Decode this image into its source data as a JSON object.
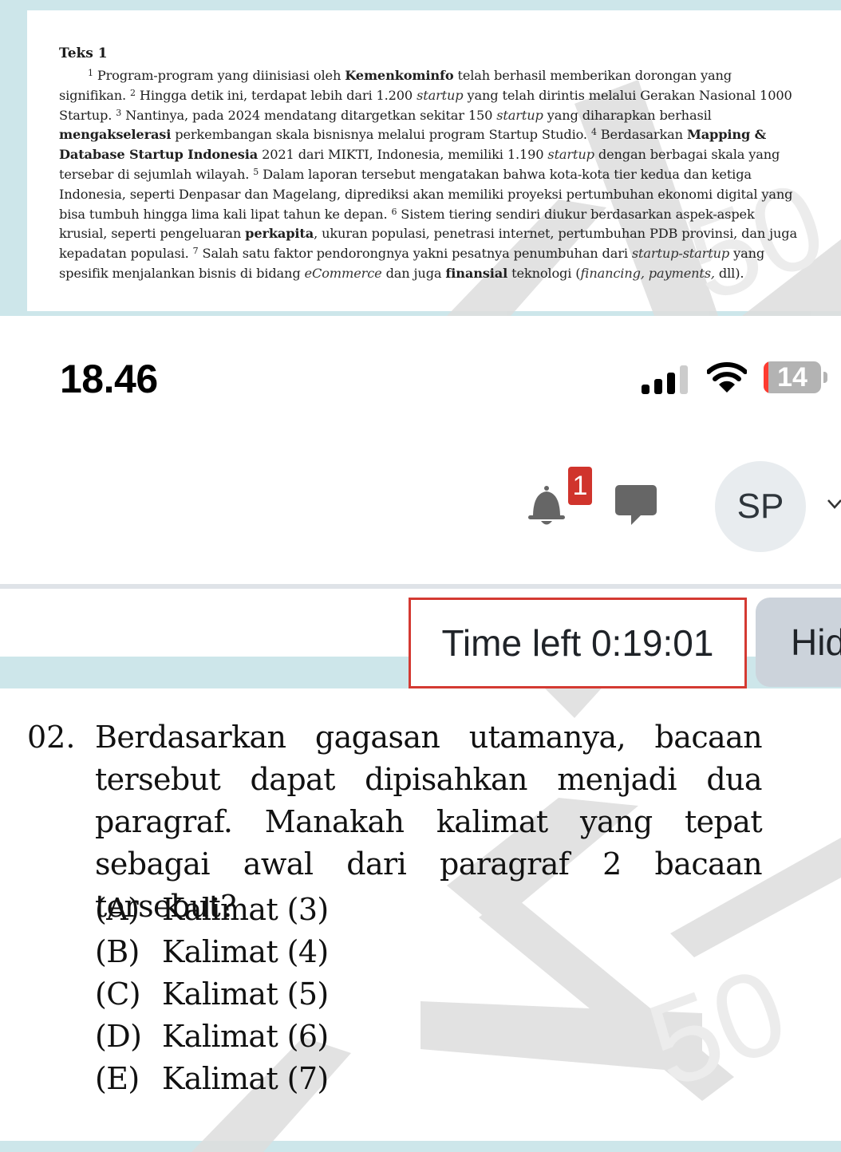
{
  "passage": {
    "title": "Teks 1",
    "sentences": [
      {
        "n": "1",
        "html": "Program-program yang diinisiasi oleh <b>Kemenkominfo</b> telah berhasil memberikan dorongan yang signifikan."
      },
      {
        "n": "2",
        "html": "Hingga detik ini, terdapat lebih dari 1.200 <i>startup</i> yang telah dirintis melalui Gerakan Nasional 1000 Startup."
      },
      {
        "n": "3",
        "html": "Nantinya, pada 2024 mendatang ditargetkan sekitar 150 <i>startup</i> yang diharapkan berhasil <b>mengakselerasi</b> perkembangan skala bisnisnya melalui program Startup Studio."
      },
      {
        "n": "4",
        "html": "Berdasarkan <b>Mapping &amp; Database Startup Indonesia</b> 2021 dari MIKTI, Indonesia, memiliki 1.190 <i>startup</i> dengan berbagai skala yang tersebar di sejumlah wilayah."
      },
      {
        "n": "5",
        "html": "Dalam laporan tersebut mengatakan bahwa kota-kota tier kedua dan ketiga Indonesia, seperti Denpasar dan Magelang, diprediksi akan memiliki proyeksi pertumbuhan ekonomi digital yang bisa tumbuh hingga lima kali lipat tahun ke depan."
      },
      {
        "n": "6",
        "html": "Sistem tiering sendiri diukur berdasarkan aspek-aspek krusial, seperti pengeluaran <b>perkapita</b>, ukuran populasi, penetrasi internet, pertumbuhan PDB provinsi, dan juga kepadatan populasi."
      },
      {
        "n": "7",
        "html": "Salah satu faktor pendorongnya yakni pesatnya penumbuhan dari <i>startup-startup</i> yang spesifik menjalankan bisnis di bidang <i>eCommerce</i> dan juga <b>finansial</b> teknologi (<i>financing, payments,</i> dll)."
      }
    ]
  },
  "status_bar": {
    "time": "18.46",
    "signal_icon": "cellular-signal-icon",
    "signal_bars_active": 3,
    "signal_bars_total": 4,
    "wifi_icon": "wifi-icon",
    "battery_percent": 14,
    "battery_label": "14"
  },
  "header": {
    "notification_icon": "bell-icon",
    "notification_count": "1",
    "messages_icon": "chat-bubble-icon",
    "avatar_initials": "SP",
    "menu_icon": "chevron-down-icon"
  },
  "timer": {
    "label": "Time left 0:19:01",
    "hide_button_label": "Hide"
  },
  "question": {
    "number": "02.",
    "text": "Berdasarkan gagasan utamanya, bacaan tersebut dapat dipisahkan menjadi dua paragraf. Manakah kalimat yang tepat sebagai awal dari paragraf 2 bacaan tersebut?",
    "options": [
      {
        "letter": "(A)",
        "text": "Kalimat (3)"
      },
      {
        "letter": "(B)",
        "text": "Kalimat (4)"
      },
      {
        "letter": "(C)",
        "text": "Kalimat (5)"
      },
      {
        "letter": "(D)",
        "text": "Kalimat (6)"
      },
      {
        "letter": "(E)",
        "text": "Kalimat (7)"
      }
    ]
  },
  "colors": {
    "band": "#cde6ea",
    "timer_border": "#d43a32",
    "badge": "#d0342c",
    "battery_low": "#ff3b30"
  }
}
